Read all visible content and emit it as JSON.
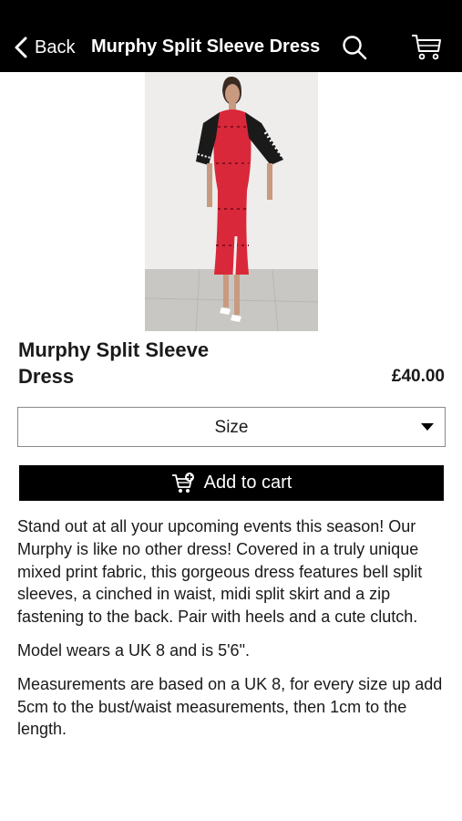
{
  "header": {
    "back_label": "Back",
    "title": "Murphy Split Sleeve Dress",
    "search_icon": "search-icon",
    "cart_icon": "shopping-cart-icon"
  },
  "product": {
    "image_icon": "product-photo",
    "name": "Murphy Split Sleeve Dress",
    "price": "£40.00",
    "size_select": {
      "label": "Size"
    },
    "add_to_cart": {
      "label": "Add to cart",
      "icon": "cart-add-icon"
    },
    "description": [
      "Stand out at all your upcoming events this season! Our Murphy is like no other dress! Covered in a truly unique mixed print fabric, this gorgeous dress features bell split sleeves, a cinched in waist, midi split skirt and a zip fastening to the back. Pair with heels and a cute clutch.",
      "Model wears a UK 8 and is 5'6\".",
      "Measurements are based on a UK 8, for every size up add 5cm to the bust/waist measurements, then 1cm to the length."
    ]
  },
  "colors": {
    "header_bg": "#000000",
    "button_bg": "#000000",
    "text": "#1a1a1a",
    "dress_red": "#d8283a"
  }
}
